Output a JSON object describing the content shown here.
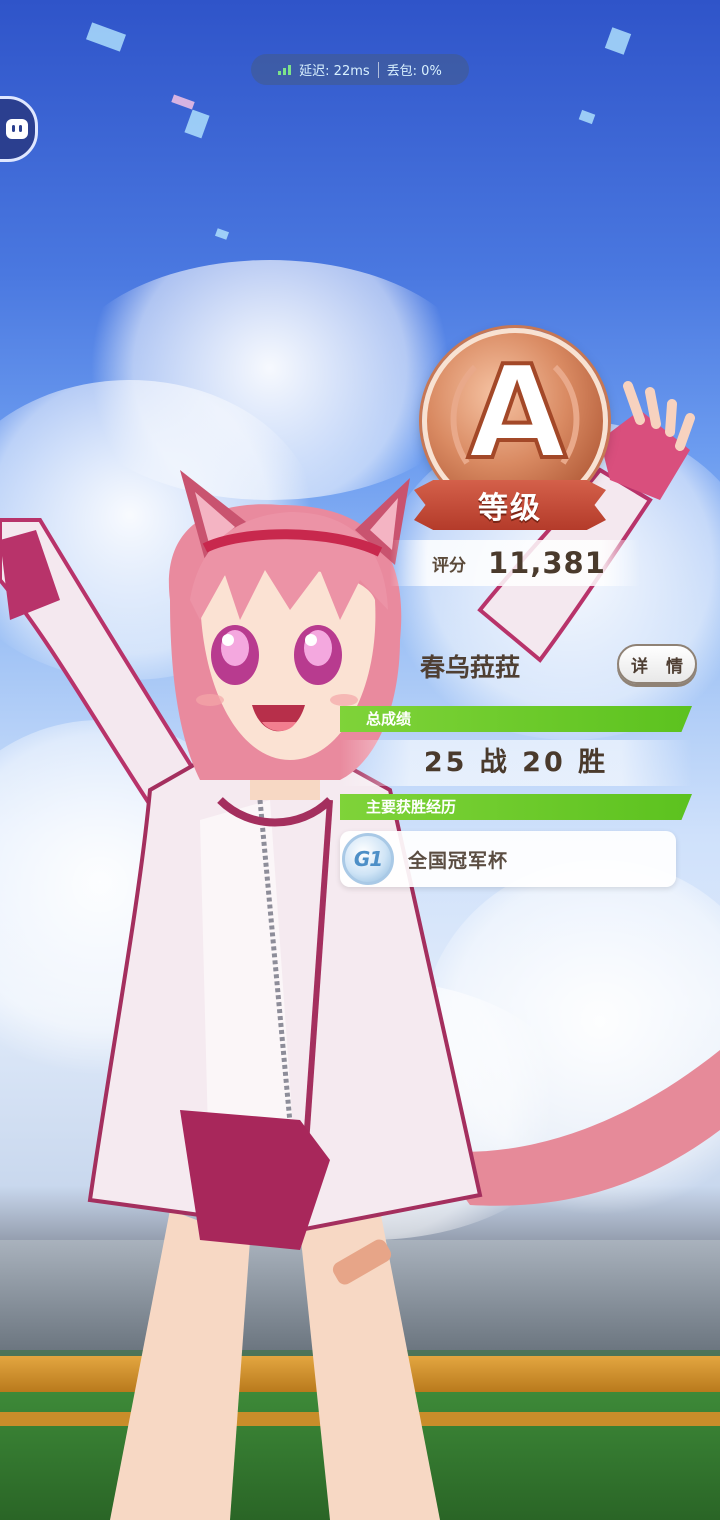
{
  "status_bar": {
    "latency": "延迟: 22ms",
    "packet_loss": "丢包: 0%"
  },
  "rank": {
    "letter": "A",
    "ribbon_label": "等级"
  },
  "score": {
    "label": "评分",
    "value": "11,381"
  },
  "trainee": {
    "name": "春乌菈菈",
    "details_label": "详 情"
  },
  "sections": {
    "total_record_title": "总成绩",
    "total_record_value": "25 战 20 胜",
    "main_wins_title": "主要获胜经历"
  },
  "main_wins": [
    {
      "grade": "G1",
      "race_name": "全国冠军杯"
    }
  ],
  "colors": {
    "accent_green": "#6cc82a",
    "rank_bronze": "#c87654",
    "ribbon_red": "#c24a35"
  }
}
